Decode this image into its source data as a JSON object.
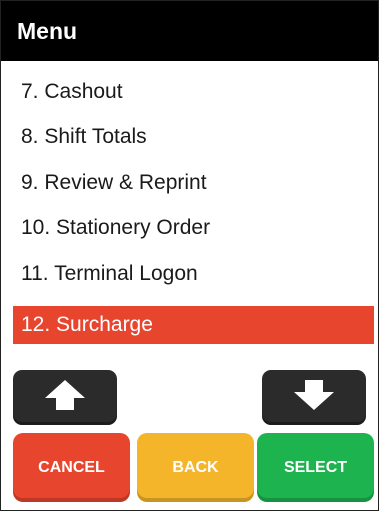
{
  "header": {
    "title": "Menu"
  },
  "menu": {
    "items": [
      {
        "label": "7. Cashout"
      },
      {
        "label": "8. Shift Totals"
      },
      {
        "label": "9. Review & Reprint"
      },
      {
        "label": "10. Stationery Order"
      },
      {
        "label": "11. Terminal Logon"
      },
      {
        "label": "12. Surcharge",
        "selected": true
      }
    ]
  },
  "nav": {
    "up_icon": "arrow-up-icon",
    "down_icon": "arrow-down-icon"
  },
  "actions": {
    "cancel": {
      "label": "CANCEL",
      "color": "#e8452f"
    },
    "back": {
      "label": "BACK",
      "color": "#f5b52a"
    },
    "select": {
      "label": "SELECT",
      "color": "#1db34f"
    }
  },
  "colors": {
    "header_bg": "#000000",
    "selected_bg": "#e8452f",
    "arrow_btn_bg": "#2b2b2b"
  }
}
